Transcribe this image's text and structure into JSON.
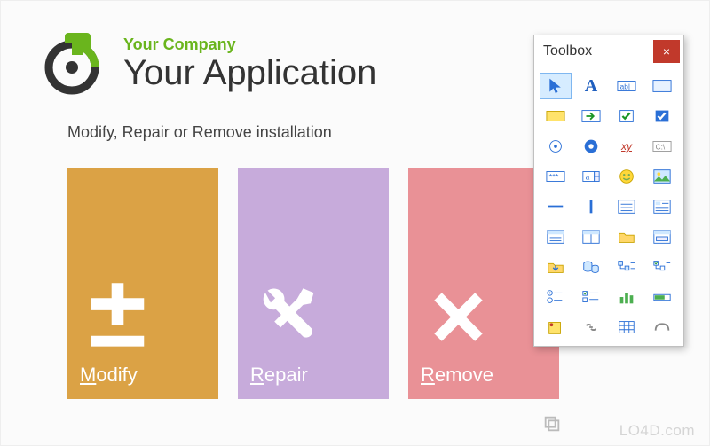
{
  "header": {
    "company": "Your Company",
    "app": "Your Application"
  },
  "subtitle": "Modify, Repair or Remove installation",
  "tiles": {
    "modify": {
      "label": "Modify",
      "accel": "M"
    },
    "repair": {
      "label": "Repair",
      "accel": "R"
    },
    "remove": {
      "label": "Remove",
      "accel": "R"
    }
  },
  "toolbox": {
    "title": "Toolbox",
    "close": "×",
    "tools": [
      "pointer",
      "text",
      "textbox",
      "panel",
      "button-yellow",
      "arrow-button",
      "checkbox",
      "checkbox-filled",
      "radio-unchecked",
      "radio-checked",
      "hyperlink",
      "path-box",
      "password",
      "updown",
      "smiley",
      "picture",
      "hline",
      "vline",
      "list-outline",
      "list-detail",
      "form-header",
      "form-split",
      "folder",
      "form-field",
      "folder-down",
      "database-group",
      "tree",
      "tree-check",
      "tree-radio",
      "checked-list",
      "bars",
      "progress",
      "note-pin",
      "chain",
      "grid-blue",
      "tab-shape"
    ]
  },
  "watermark": "LO4D.com"
}
